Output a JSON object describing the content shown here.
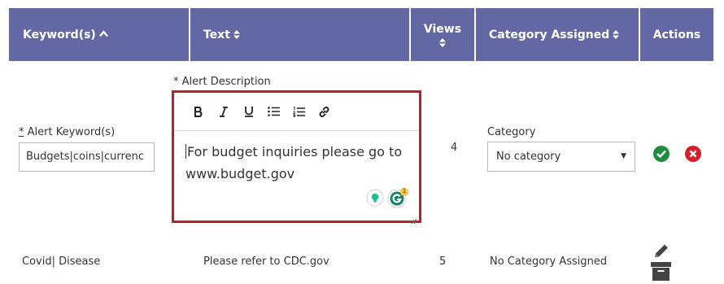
{
  "table": {
    "headers": {
      "keywords": "Keyword(s)",
      "text": "Text",
      "views": "Views",
      "category": "Category Assigned",
      "actions": "Actions"
    },
    "edit_row": {
      "keyword_label": "* Alert Keyword(s)",
      "keyword_value": "Budgets|coins|currenc",
      "description_label": "* Alert Description",
      "description_text_line1": "For budget inquiries please go to",
      "description_text_line2": "www.budget.gov",
      "grammarly_badge": "1",
      "views": "4",
      "category_label": "Category",
      "category_selected": "No category"
    },
    "rows": [
      {
        "keywords": "Covid| Disease",
        "text": "Please refer to CDC.gov",
        "views": "5",
        "category": "No Category Assigned"
      }
    ]
  },
  "colors": {
    "header_bg": "#6367a3",
    "highlight_border": "#b8202f",
    "confirm": "#1e8e3e",
    "cancel": "#d4202c"
  },
  "icons": [
    "sort-up-icon",
    "sort-both-icon",
    "bold-icon",
    "italic-icon",
    "underline-icon",
    "bullet-list-icon",
    "numbered-list-icon",
    "link-icon",
    "grammarly-icon",
    "lightbulb-icon",
    "check-icon",
    "close-icon",
    "edit-pencil-icon",
    "archive-icon",
    "dropdown-arrow-icon"
  ]
}
